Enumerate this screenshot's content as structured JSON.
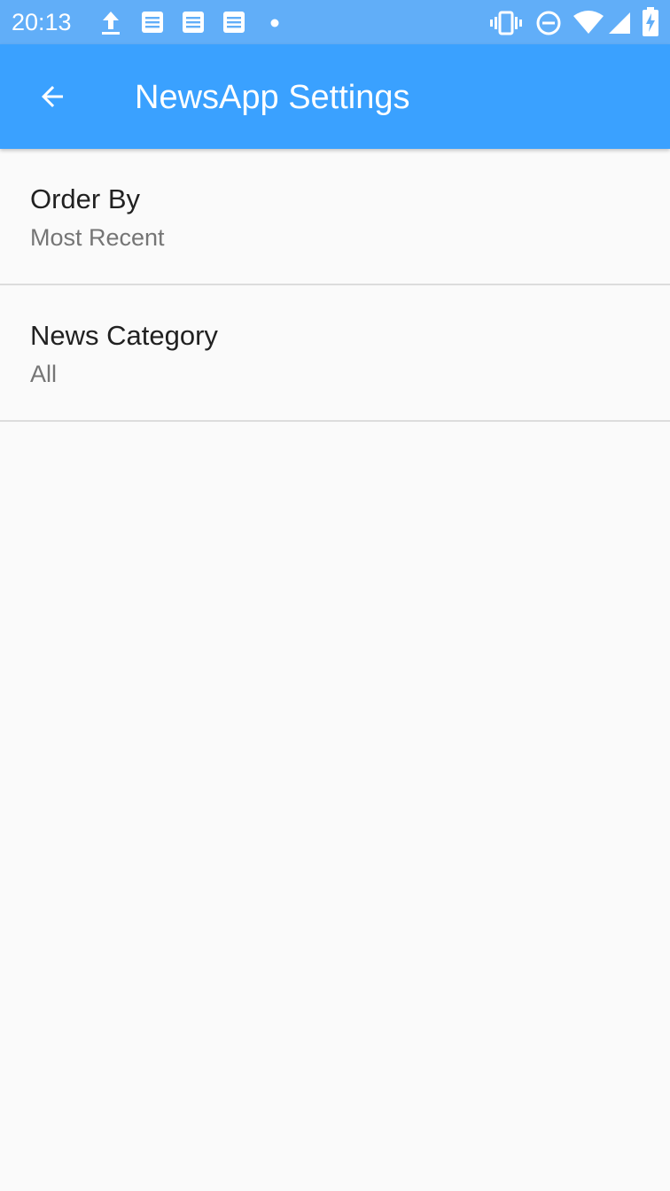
{
  "status_bar": {
    "time": "20:13",
    "left_icons": [
      "upload-icon",
      "notes-icon",
      "notes-icon",
      "notes-icon",
      "dot-icon"
    ],
    "right_icons": [
      "vibrate-icon",
      "do-not-disturb-icon",
      "wifi-icon",
      "cell-signal-icon",
      "battery-charging-icon"
    ]
  },
  "app_bar": {
    "title": "NewsApp Settings",
    "back_icon": "arrow-back-icon",
    "color": "#3AA1FF"
  },
  "preferences": [
    {
      "title": "Order By",
      "summary": "Most Recent"
    },
    {
      "title": "News Category",
      "summary": "All"
    }
  ],
  "colors": {
    "status_bar": "#61AEF8",
    "background": "#FAFAFA",
    "title_text": "#212121",
    "summary_text": "#757575",
    "divider": "#DCDCDC"
  }
}
